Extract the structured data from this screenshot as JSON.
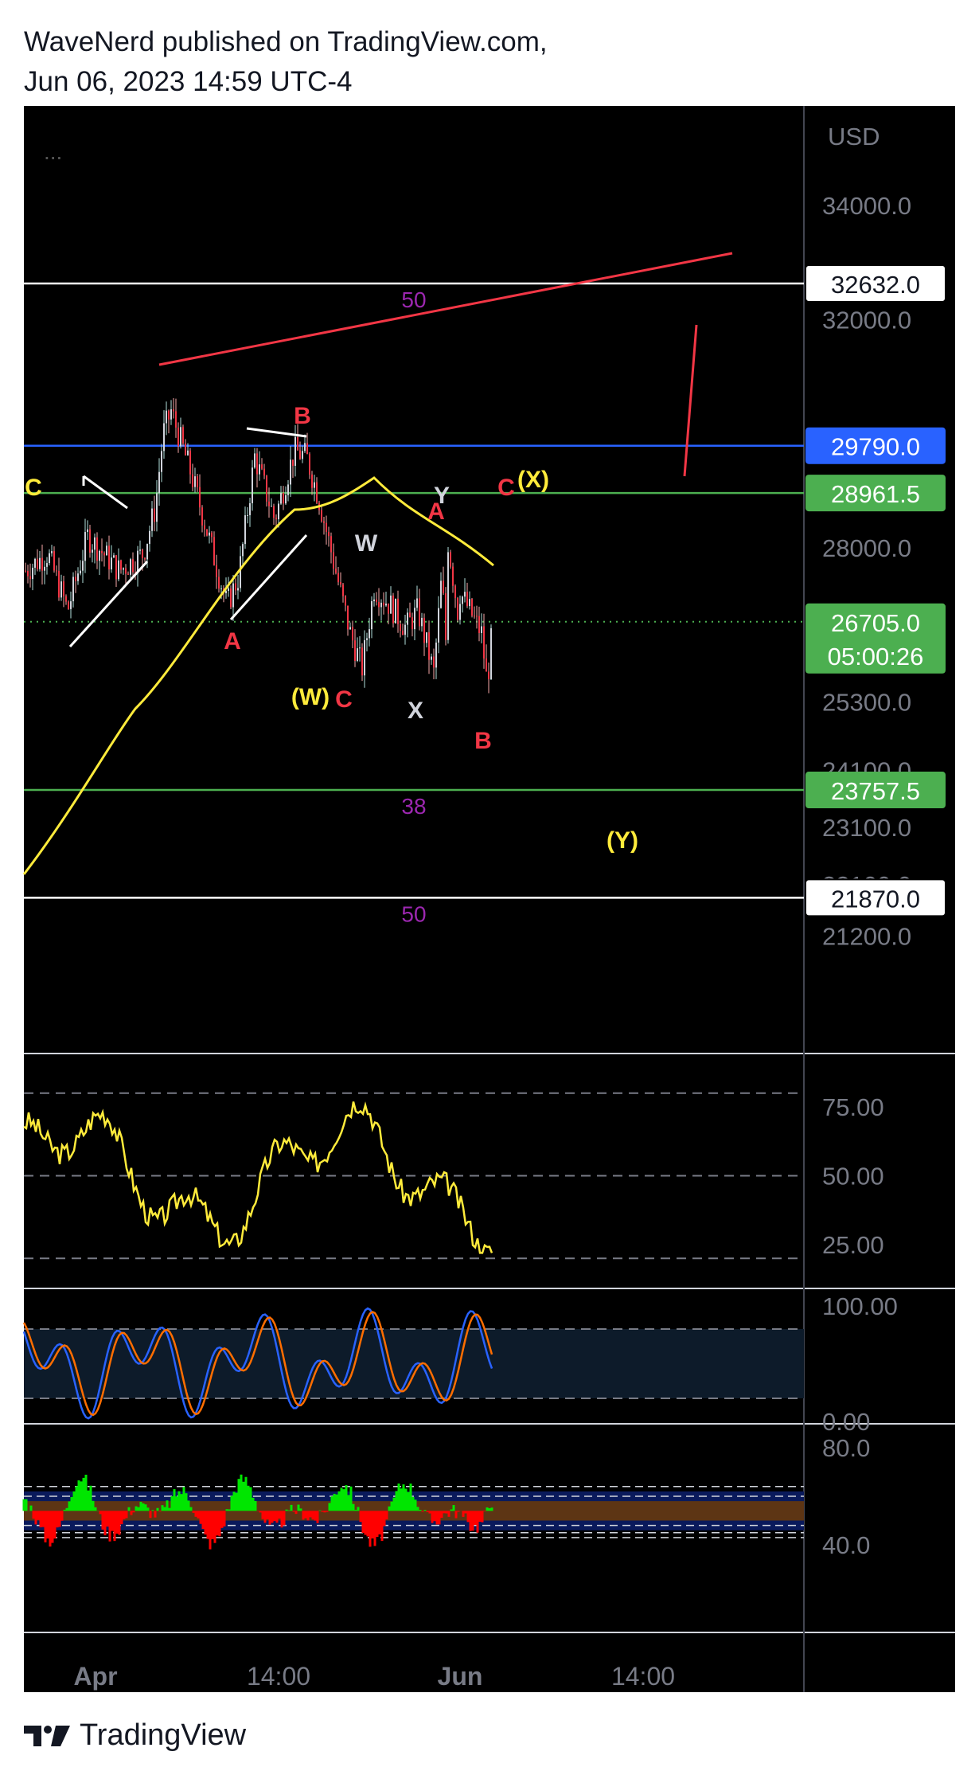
{
  "header": {
    "line1": "WaveNerd published on TradingView.com,",
    "line2": "Jun 06, 2023 14:59 UTC-4"
  },
  "footer": {
    "brand": "TradingView"
  },
  "colors": {
    "background": "#000000",
    "axis_text": "#787b86",
    "white_level": "#ffffff",
    "blue_level": "#2962ff",
    "green_level": "#4caf50",
    "trend_red": "#f23645",
    "ma_yellow": "#ffeb3b",
    "wave_yellow": "#ffeb3b",
    "wave_red": "#f23645",
    "wave_white": "#d1d4dc",
    "fib_purple": "#9c27b0",
    "rsi_yellow": "#ffeb3b",
    "stoch_blue": "#2962ff",
    "stoch_orange": "#ff6d00",
    "last_price_green": "#4caf50"
  },
  "chart_data": [
    {
      "type": "candlestick",
      "currency_label": "USD",
      "more_indicator": "...",
      "y_ticks": [
        "34000.0",
        "32000.0",
        "28000.0",
        "25300.0",
        "24100.0",
        "23100.0",
        "22100.0",
        "21200.0"
      ],
      "x_ticks": [
        "Apr",
        "14:00",
        "Jun",
        "14:00"
      ],
      "price_labels": [
        {
          "value": "32632.0",
          "style": "white"
        },
        {
          "value": "29790.0",
          "style": "blue"
        },
        {
          "value": "28961.5",
          "style": "green"
        },
        {
          "value": "26705.0",
          "style": "green",
          "countdown": "05:00:26"
        },
        {
          "value": "23757.5",
          "style": "green"
        },
        {
          "value": "21870.0",
          "style": "white"
        }
      ],
      "horizontal_levels": [
        {
          "price": 32632.0,
          "color": "white",
          "label": "50"
        },
        {
          "price": 29790.0,
          "color": "blue"
        },
        {
          "price": 28961.5,
          "color": "green"
        },
        {
          "price": 26705.0,
          "color": "green",
          "style": "dotted"
        },
        {
          "price": 23757.5,
          "color": "green",
          "label": "38"
        },
        {
          "price": 21870.0,
          "color": "white",
          "label": "50"
        }
      ],
      "wave_labels": [
        {
          "text": "C",
          "color": "yellow"
        },
        {
          "text": "B",
          "color": "red"
        },
        {
          "text": "A",
          "color": "red"
        },
        {
          "text": "(W)",
          "color": "yellow"
        },
        {
          "text": "C",
          "color": "red"
        },
        {
          "text": "W",
          "color": "white"
        },
        {
          "text": "X",
          "color": "white"
        },
        {
          "text": "Y",
          "color": "white"
        },
        {
          "text": "A",
          "color": "red"
        },
        {
          "text": "C",
          "color": "red"
        },
        {
          "text": "(X)",
          "color": "yellow"
        },
        {
          "text": "B",
          "color": "red"
        },
        {
          "text": "(Y)",
          "color": "yellow"
        }
      ],
      "last_price": 26705.0
    },
    {
      "type": "line",
      "indicator": "RSI",
      "y_ticks": [
        "75.00",
        "50.00",
        "25.00"
      ],
      "levels": [
        80,
        50,
        20
      ]
    },
    {
      "type": "line",
      "indicator": "Stochastic RSI",
      "y_ticks": [
        "100.00",
        "0.00"
      ],
      "band": [
        20,
        80
      ]
    },
    {
      "type": "area",
      "indicator": "Oscillator histogram",
      "y_ticks": [
        "80.0",
        "40.0"
      ]
    }
  ]
}
